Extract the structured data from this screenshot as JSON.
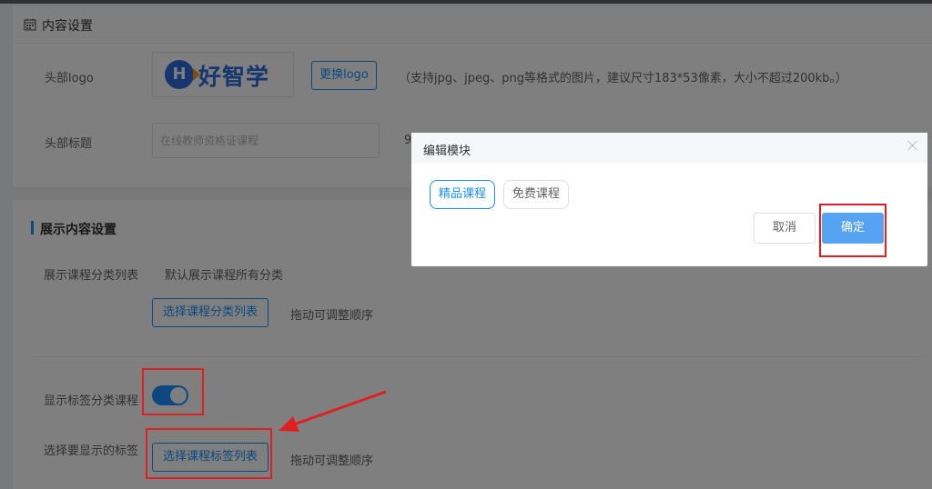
{
  "content_settings": {
    "title": "内容设置",
    "logo_label": "头部logo",
    "logo_text": "好智学",
    "logo_letter": "H",
    "change_logo_button": "更换logo",
    "logo_hint": "（支持jpg、jpeg、png等格式的图片，建议尺寸183*53像素，大小不超过200kb。）",
    "header_title_label": "头部标题",
    "header_title_placeholder": "在线教师资格证课程",
    "header_title_hint_prefix": "9"
  },
  "display_settings": {
    "title": "展示内容设置",
    "category_list_label": "展示课程分类列表",
    "category_list_default": "默认展示课程所有分类",
    "select_category_button": "选择课程分类列表",
    "drag_hint": "拖动可调整顺序",
    "show_tag_courses_label": "显示标签分类课程",
    "show_tag_courses_enabled": true,
    "select_tags_label": "选择要显示的标签",
    "select_tags_button": "选择课程标签列表",
    "drag_hint_2": "拖动可调整顺序"
  },
  "dialog": {
    "title": "编辑模块",
    "tags": [
      {
        "label": "精品课程",
        "active": true
      },
      {
        "label": "免费课程",
        "active": false
      }
    ],
    "cancel_label": "取消",
    "ok_label": "确定"
  },
  "colors": {
    "accent": "#1890ff",
    "annotation": "#e02020"
  },
  "icons": {
    "section_icon": "calendar-icon",
    "dialog_close": "close-icon"
  }
}
